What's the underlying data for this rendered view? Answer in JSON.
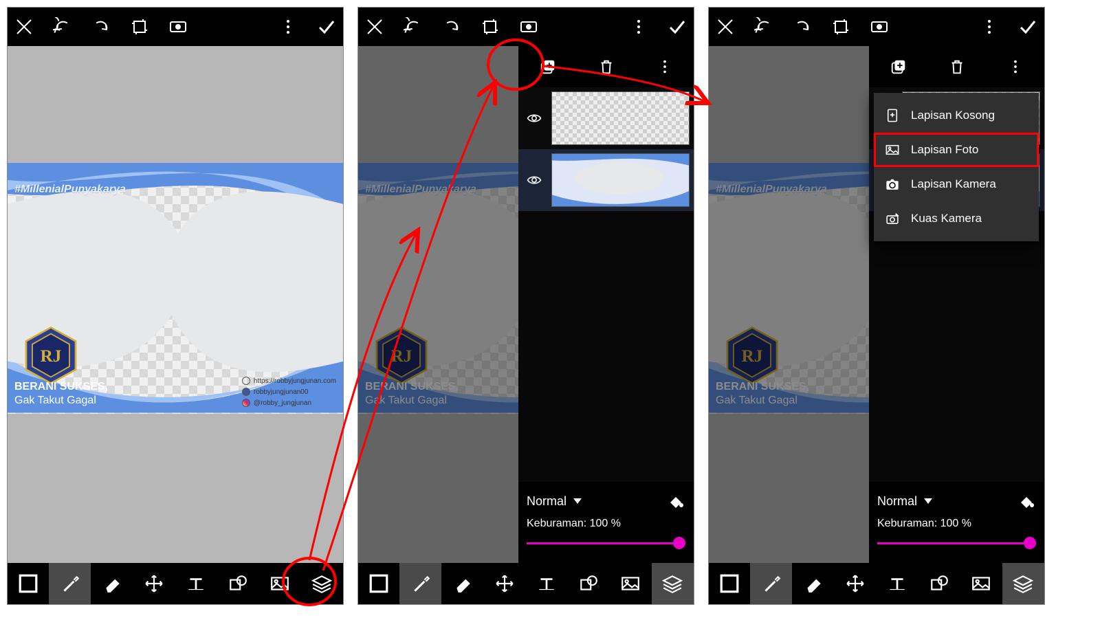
{
  "artwork": {
    "hashtag": "#MillenialPunyakarya",
    "line1": "BERANI SUKSES,",
    "line2": "Gak Takut Gagal",
    "website_label": "https://robbyjungjunan.com",
    "facebook_label": "robbyjungjunan00",
    "instagram_label": "@robby_jungjunan"
  },
  "layers": {
    "blend_mode": "Normal",
    "opacity_label": "Keburaman: 100 %"
  },
  "menu": {
    "empty": "Lapisan Kosong",
    "photo": "Lapisan Foto",
    "camera": "Lapisan Kamera",
    "brush_camera": "Kuas Kamera"
  }
}
